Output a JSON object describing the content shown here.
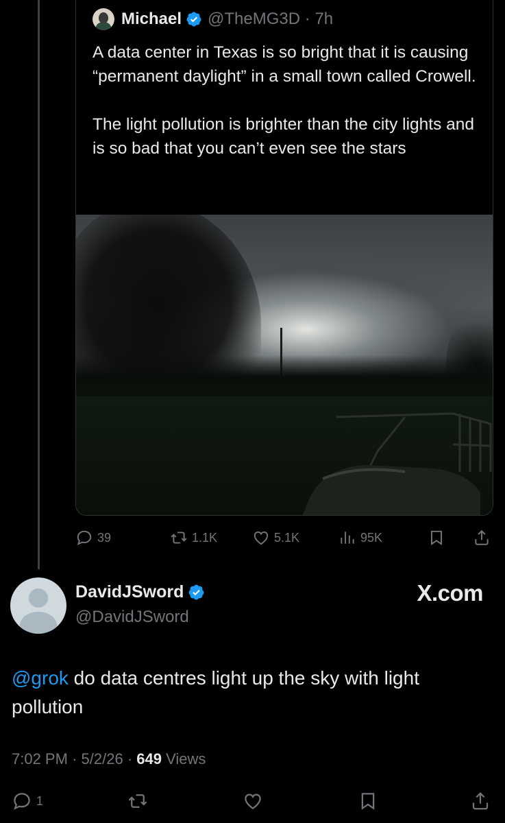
{
  "quoted_post": {
    "author_name": "Michael",
    "author_handle": "@TheMG3D",
    "separator": "·",
    "time": "7h",
    "text": "A data center in Texas is so bright that it is causing “permanent daylight” in a small town called Crowell.\n\nThe light pollution is brighter than the city lights and is so bad that you can’t even see the stars",
    "media_icon": "photo-of-glowing-night-sky",
    "stats": {
      "replies": "39",
      "reposts": "1.1K",
      "likes": "5.1K",
      "views": "95K"
    }
  },
  "main_post": {
    "author_name": "DavidJSword",
    "author_handle": "@DavidJSword",
    "watermark": "X.com",
    "mention": "@grok",
    "text": " do data centres light up the sky with light pollution",
    "time": "7:02 PM",
    "date": "5/2/26",
    "views_count": "649",
    "views_label": "Views",
    "separator": "·",
    "replies": "1"
  },
  "colors": {
    "background": "#000000",
    "text": "#e7e9ea",
    "muted": "#71767b",
    "accent": "#1d9bf0",
    "border": "#2f3336"
  }
}
